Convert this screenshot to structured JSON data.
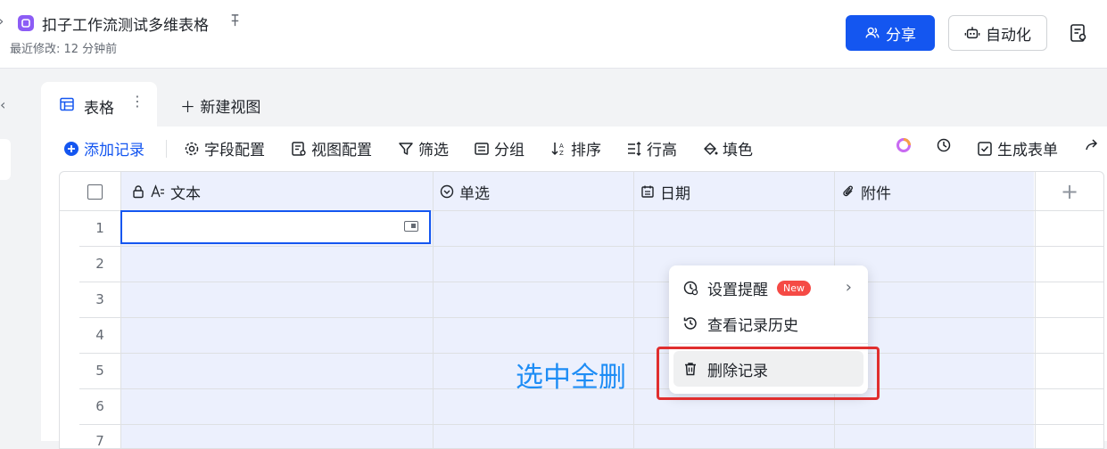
{
  "header": {
    "title": "扣子工作流测试多维表格",
    "modified": "最近修改: 12 分钟前",
    "share_label": "分享",
    "automation_label": "自动化"
  },
  "tabs": {
    "active_label": "表格",
    "new_view_label": "新建视图"
  },
  "toolbar": {
    "add_record": "添加记录",
    "field_config": "字段配置",
    "view_config": "视图配置",
    "filter": "筛选",
    "group": "分组",
    "sort": "排序",
    "row_height": "行高",
    "fill_color": "填色",
    "generate_form": "生成表单"
  },
  "grid": {
    "columns": [
      "文本",
      "单选",
      "日期",
      "附件"
    ],
    "row_numbers": [
      "1",
      "2",
      "3",
      "4",
      "5",
      "6",
      "7"
    ]
  },
  "context_menu": {
    "set_reminder": "设置提醒",
    "new_badge": "New",
    "view_history": "查看记录历史",
    "delete_record": "删除记录"
  },
  "annotation": "选中全删",
  "colors": {
    "primary": "#1456f0",
    "selected_col_bg": "#ecf0fd",
    "highlight_red": "#e02e2e",
    "annotation_blue": "#1e8df5"
  }
}
